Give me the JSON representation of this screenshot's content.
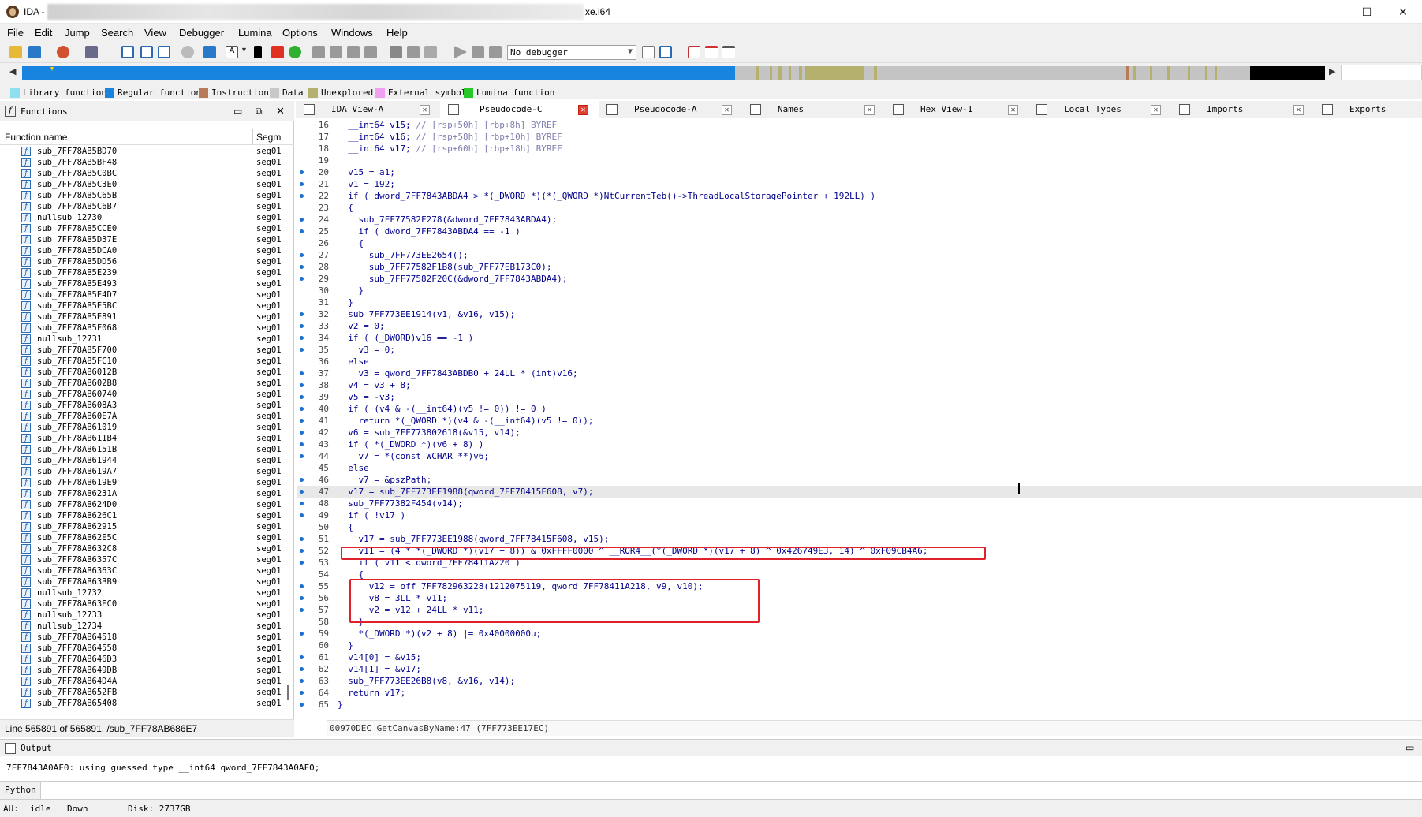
{
  "window": {
    "title_prefix": "IDA - ",
    "title_suffix": "xe.i64",
    "minimize": "—",
    "maximize": "☐",
    "close": "✕"
  },
  "menu": [
    "File",
    "Edit",
    "Jump",
    "Search",
    "View",
    "Debugger",
    "Lumina",
    "Options",
    "Windows",
    "Help"
  ],
  "toolbar": {
    "debugger_select": "No debugger"
  },
  "legend": [
    {
      "label": "Library function",
      "color": "#8ee0f0"
    },
    {
      "label": "Regular function",
      "color": "#1884e0"
    },
    {
      "label": "Instruction",
      "color": "#b97a57"
    },
    {
      "label": "Data",
      "color": "#c8c8c8"
    },
    {
      "label": "Unexplored",
      "color": "#b5b06e"
    },
    {
      "label": "External symbol",
      "color": "#f0a0f0"
    },
    {
      "label": "Lumina function",
      "color": "#28c828"
    }
  ],
  "functions_panel": {
    "title": "Functions",
    "col_name": "Function name",
    "col_segment": "Segm",
    "rows": [
      {
        "name": "sub_7FF78AB5BD70",
        "seg": "seg01"
      },
      {
        "name": "sub_7FF78AB5BF48",
        "seg": "seg01"
      },
      {
        "name": "sub_7FF78AB5C0BC",
        "seg": "seg01"
      },
      {
        "name": "sub_7FF78AB5C3E0",
        "seg": "seg01"
      },
      {
        "name": "sub_7FF78AB5C65B",
        "seg": "seg01"
      },
      {
        "name": "sub_7FF78AB5C6B7",
        "seg": "seg01"
      },
      {
        "name": "nullsub_12730",
        "seg": "seg01"
      },
      {
        "name": "sub_7FF78AB5CCE0",
        "seg": "seg01"
      },
      {
        "name": "sub_7FF78AB5D37E",
        "seg": "seg01"
      },
      {
        "name": "sub_7FF78AB5DCA0",
        "seg": "seg01"
      },
      {
        "name": "sub_7FF78AB5DD56",
        "seg": "seg01"
      },
      {
        "name": "sub_7FF78AB5E239",
        "seg": "seg01"
      },
      {
        "name": "sub_7FF78AB5E493",
        "seg": "seg01"
      },
      {
        "name": "sub_7FF78AB5E4D7",
        "seg": "seg01"
      },
      {
        "name": "sub_7FF78AB5E5BC",
        "seg": "seg01"
      },
      {
        "name": "sub_7FF78AB5E891",
        "seg": "seg01"
      },
      {
        "name": "sub_7FF78AB5F068",
        "seg": "seg01"
      },
      {
        "name": "nullsub_12731",
        "seg": "seg01"
      },
      {
        "name": "sub_7FF78AB5F700",
        "seg": "seg01"
      },
      {
        "name": "sub_7FF78AB5FC10",
        "seg": "seg01"
      },
      {
        "name": "sub_7FF78AB6012B",
        "seg": "seg01"
      },
      {
        "name": "sub_7FF78AB602B8",
        "seg": "seg01"
      },
      {
        "name": "sub_7FF78AB60740",
        "seg": "seg01"
      },
      {
        "name": "sub_7FF78AB608A3",
        "seg": "seg01"
      },
      {
        "name": "sub_7FF78AB60E7A",
        "seg": "seg01"
      },
      {
        "name": "sub_7FF78AB61019",
        "seg": "seg01"
      },
      {
        "name": "sub_7FF78AB611B4",
        "seg": "seg01"
      },
      {
        "name": "sub_7FF78AB6151B",
        "seg": "seg01"
      },
      {
        "name": "sub_7FF78AB61944",
        "seg": "seg01"
      },
      {
        "name": "sub_7FF78AB619A7",
        "seg": "seg01"
      },
      {
        "name": "sub_7FF78AB619E9",
        "seg": "seg01"
      },
      {
        "name": "sub_7FF78AB6231A",
        "seg": "seg01"
      },
      {
        "name": "sub_7FF78AB624D0",
        "seg": "seg01"
      },
      {
        "name": "sub_7FF78AB626C1",
        "seg": "seg01"
      },
      {
        "name": "sub_7FF78AB62915",
        "seg": "seg01"
      },
      {
        "name": "sub_7FF78AB62E5C",
        "seg": "seg01"
      },
      {
        "name": "sub_7FF78AB632C8",
        "seg": "seg01"
      },
      {
        "name": "sub_7FF78AB6357C",
        "seg": "seg01"
      },
      {
        "name": "sub_7FF78AB6363C",
        "seg": "seg01"
      },
      {
        "name": "sub_7FF78AB63BB9",
        "seg": "seg01"
      },
      {
        "name": "nullsub_12732",
        "seg": "seg01"
      },
      {
        "name": "sub_7FF78AB63EC0",
        "seg": "seg01"
      },
      {
        "name": "nullsub_12733",
        "seg": "seg01"
      },
      {
        "name": "nullsub_12734",
        "seg": "seg01"
      },
      {
        "name": "sub_7FF78AB64518",
        "seg": "seg01"
      },
      {
        "name": "sub_7FF78AB64558",
        "seg": "seg01"
      },
      {
        "name": "sub_7FF78AB646D3",
        "seg": "seg01"
      },
      {
        "name": "sub_7FF78AB649DB",
        "seg": "seg01"
      },
      {
        "name": "sub_7FF78AB64D4A",
        "seg": "seg01"
      },
      {
        "name": "sub_7FF78AB652FB",
        "seg": "seg01"
      },
      {
        "name": "sub_7FF78AB65408",
        "seg": "seg01"
      }
    ],
    "status": "Line 565891 of 565891, /sub_7FF78AB686E7"
  },
  "tabs": [
    {
      "label": "IDA View-A",
      "active": false
    },
    {
      "label": "Pseudocode-C",
      "active": true
    },
    {
      "label": "Pseudocode-A",
      "active": false
    },
    {
      "label": "Names",
      "active": false
    },
    {
      "label": "Hex View-1",
      "active": false
    },
    {
      "label": "Local Types",
      "active": false
    },
    {
      "label": "Imports",
      "active": false
    },
    {
      "label": "Exports",
      "active": false
    }
  ],
  "code_lines": [
    {
      "n": "16",
      "dot": false,
      "t": "  __int64 v15; // [rsp+50h] [rbp+8h] BYREF"
    },
    {
      "n": "17",
      "dot": false,
      "t": "  __int64 v16; // [rsp+58h] [rbp+10h] BYREF"
    },
    {
      "n": "18",
      "dot": false,
      "t": "  __int64 v17; // [rsp+60h] [rbp+18h] BYREF"
    },
    {
      "n": "19",
      "dot": false,
      "t": ""
    },
    {
      "n": "20",
      "dot": true,
      "t": "  v15 = a1;"
    },
    {
      "n": "21",
      "dot": true,
      "t": "  v1 = 192;"
    },
    {
      "n": "22",
      "dot": true,
      "t": "  if ( dword_7FF7843ABDA4 > *(_DWORD *)(*(_QWORD *)NtCurrentTeb()->ThreadLocalStoragePointer + 192LL) )"
    },
    {
      "n": "23",
      "dot": false,
      "t": "  {"
    },
    {
      "n": "24",
      "dot": true,
      "t": "    sub_7FF77582F278(&dword_7FF7843ABDA4);"
    },
    {
      "n": "25",
      "dot": true,
      "t": "    if ( dword_7FF7843ABDA4 == -1 )"
    },
    {
      "n": "26",
      "dot": false,
      "t": "    {"
    },
    {
      "n": "27",
      "dot": true,
      "t": "      sub_7FF773EE2654();"
    },
    {
      "n": "28",
      "dot": true,
      "t": "      sub_7FF77582F1B8(sub_7FF77EB173C0);"
    },
    {
      "n": "29",
      "dot": true,
      "t": "      sub_7FF77582F20C(&dword_7FF7843ABDA4);"
    },
    {
      "n": "30",
      "dot": false,
      "t": "    }"
    },
    {
      "n": "31",
      "dot": false,
      "t": "  }"
    },
    {
      "n": "32",
      "dot": true,
      "t": "  sub_7FF773EE1914(v1, &v16, v15);"
    },
    {
      "n": "33",
      "dot": true,
      "t": "  v2 = 0;"
    },
    {
      "n": "34",
      "dot": true,
      "t": "  if ( (_DWORD)v16 == -1 )"
    },
    {
      "n": "35",
      "dot": true,
      "t": "    v3 = 0;"
    },
    {
      "n": "36",
      "dot": false,
      "t": "  else"
    },
    {
      "n": "37",
      "dot": true,
      "t": "    v3 = qword_7FF7843ABDB0 + 24LL * (int)v16;"
    },
    {
      "n": "38",
      "dot": true,
      "t": "  v4 = v3 + 8;"
    },
    {
      "n": "39",
      "dot": true,
      "t": "  v5 = -v3;"
    },
    {
      "n": "40",
      "dot": true,
      "t": "  if ( (v4 & -(__int64)(v5 != 0)) != 0 )"
    },
    {
      "n": "41",
      "dot": true,
      "t": "    return *(_QWORD *)(v4 & -(__int64)(v5 != 0));"
    },
    {
      "n": "42",
      "dot": true,
      "t": "  v6 = sub_7FF773802618(&v15, v14);"
    },
    {
      "n": "43",
      "dot": true,
      "t": "  if ( *(_DWORD *)(v6 + 8) )"
    },
    {
      "n": "44",
      "dot": true,
      "t": "    v7 = *(const WCHAR **)v6;"
    },
    {
      "n": "45",
      "dot": false,
      "t": "  else"
    },
    {
      "n": "46",
      "dot": true,
      "t": "    v7 = &pszPath;"
    },
    {
      "n": "47",
      "dot": true,
      "t": "  v17 = sub_7FF773EE1988(qword_7FF78415F608, v7);"
    },
    {
      "n": "48",
      "dot": true,
      "t": "  sub_7FF77382F454(v14);"
    },
    {
      "n": "49",
      "dot": true,
      "t": "  if ( !v17 )"
    },
    {
      "n": "50",
      "dot": false,
      "t": "  {"
    },
    {
      "n": "51",
      "dot": true,
      "t": "    v17 = sub_7FF773EE1988(qword_7FF78415F608, v15);"
    },
    {
      "n": "52",
      "dot": true,
      "t": "    v11 = (4 * *(_DWORD *)(v17 + 8)) & 0xFFFF0000 ^ __ROR4__(*(_DWORD *)(v17 + 8) ^ 0x426749E3, 14) ^ 0xF09CB4A6;"
    },
    {
      "n": "53",
      "dot": true,
      "t": "    if ( v11 < dword_7FF78411A220 )"
    },
    {
      "n": "54",
      "dot": false,
      "t": "    {"
    },
    {
      "n": "55",
      "dot": true,
      "t": "      v12 = off_7FF782963228(1212075119, qword_7FF78411A218, v9, v10);"
    },
    {
      "n": "56",
      "dot": true,
      "t": "      v8 = 3LL * v11;"
    },
    {
      "n": "57",
      "dot": true,
      "t": "      v2 = v12 + 24LL * v11;"
    },
    {
      "n": "58",
      "dot": false,
      "t": "    }"
    },
    {
      "n": "59",
      "dot": true,
      "t": "    *(_DWORD *)(v2 + 8) |= 0x40000000u;"
    },
    {
      "n": "60",
      "dot": false,
      "t": "  }"
    },
    {
      "n": "61",
      "dot": true,
      "t": "  v14[0] = &v15;"
    },
    {
      "n": "62",
      "dot": true,
      "t": "  v14[1] = &v17;"
    },
    {
      "n": "63",
      "dot": true,
      "t": "  sub_7FF773EE26B8(v8, &v16, v14);"
    },
    {
      "n": "64",
      "dot": true,
      "t": "  return v17;"
    },
    {
      "n": "65",
      "dot": true,
      "t": "}"
    }
  ],
  "code_status": "00970DEC GetCanvasByName:47 (7FF773EE17EC)",
  "output": {
    "title": "Output",
    "text": "7FF7843A0AF0: using guessed type __int64 qword_7FF7843A0AF0;"
  },
  "python_label": "Python",
  "status": {
    "au": "AU:",
    "state": "idle",
    "direction": "Down",
    "disk": "Disk: 2737GB"
  }
}
